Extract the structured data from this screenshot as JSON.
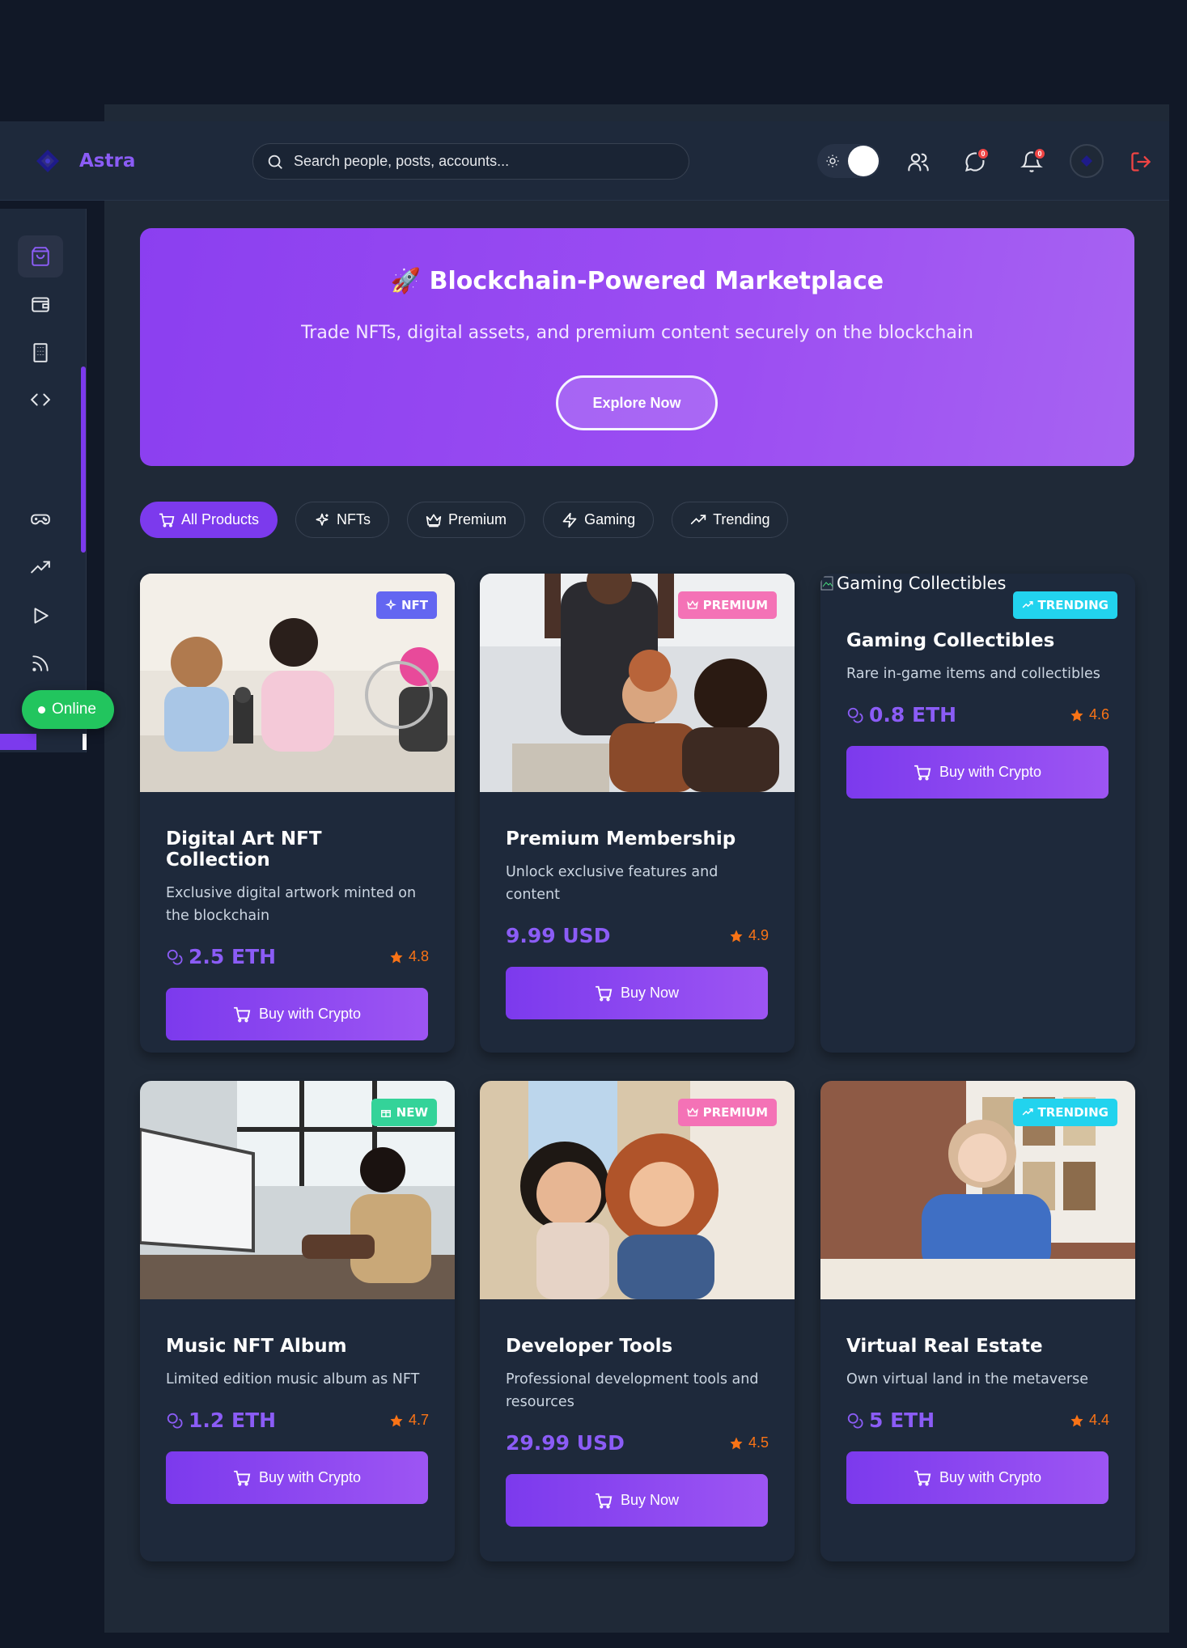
{
  "app": {
    "name": "Astra"
  },
  "search": {
    "placeholder": "Search people, posts, accounts..."
  },
  "header": {
    "messages_badge": "0",
    "notifications_badge": "0"
  },
  "status": {
    "online_label": "Online"
  },
  "hero": {
    "title": "🚀 Blockchain-Powered Marketplace",
    "subtitle": "Trade NFTs, digital assets, and premium content securely on the blockchain",
    "cta": "Explore Now"
  },
  "filters": [
    {
      "label": "All Products",
      "icon": "cart-icon",
      "active": true
    },
    {
      "label": "NFTs",
      "icon": "sparkles-icon",
      "active": false
    },
    {
      "label": "Premium",
      "icon": "crown-icon",
      "active": false
    },
    {
      "label": "Gaming",
      "icon": "lightning-icon",
      "active": false
    },
    {
      "label": "Trending",
      "icon": "trending-up-icon",
      "active": false
    }
  ],
  "products": [
    {
      "title": "Digital Art NFT Collection",
      "description": "Exclusive digital artwork minted on the blockchain",
      "price": "2.5 ETH",
      "crypto": true,
      "rating": "4.8",
      "tag": "NFT",
      "button": "Buy with Crypto"
    },
    {
      "title": "Premium Membership",
      "description": "Unlock exclusive features and content",
      "price": "9.99 USD",
      "crypto": false,
      "rating": "4.9",
      "tag": "PREMIUM",
      "button": "Buy Now"
    },
    {
      "title": "Gaming Collectibles",
      "description": "Rare in-game items and collectibles",
      "price": "0.8 ETH",
      "crypto": true,
      "rating": "4.6",
      "tag": "TRENDING",
      "button": "Buy with Crypto",
      "image_alt": "Gaming Collectibles"
    },
    {
      "title": "Music NFT Album",
      "description": "Limited edition music album as NFT",
      "price": "1.2 ETH",
      "crypto": true,
      "rating": "4.7",
      "tag": "NEW",
      "button": "Buy with Crypto"
    },
    {
      "title": "Developer Tools",
      "description": "Professional development tools and resources",
      "price": "29.99 USD",
      "crypto": false,
      "rating": "4.5",
      "tag": "PREMIUM",
      "button": "Buy Now"
    },
    {
      "title": "Virtual Real Estate",
      "description": "Own virtual land in the metaverse",
      "price": "5 ETH",
      "crypto": true,
      "rating": "4.4",
      "tag": "TRENDING",
      "button": "Buy with Crypto"
    }
  ],
  "colors": {
    "accent": "#7c3aed",
    "online": "#22c55e",
    "rating": "#f97316",
    "badge": "#ef4444"
  }
}
